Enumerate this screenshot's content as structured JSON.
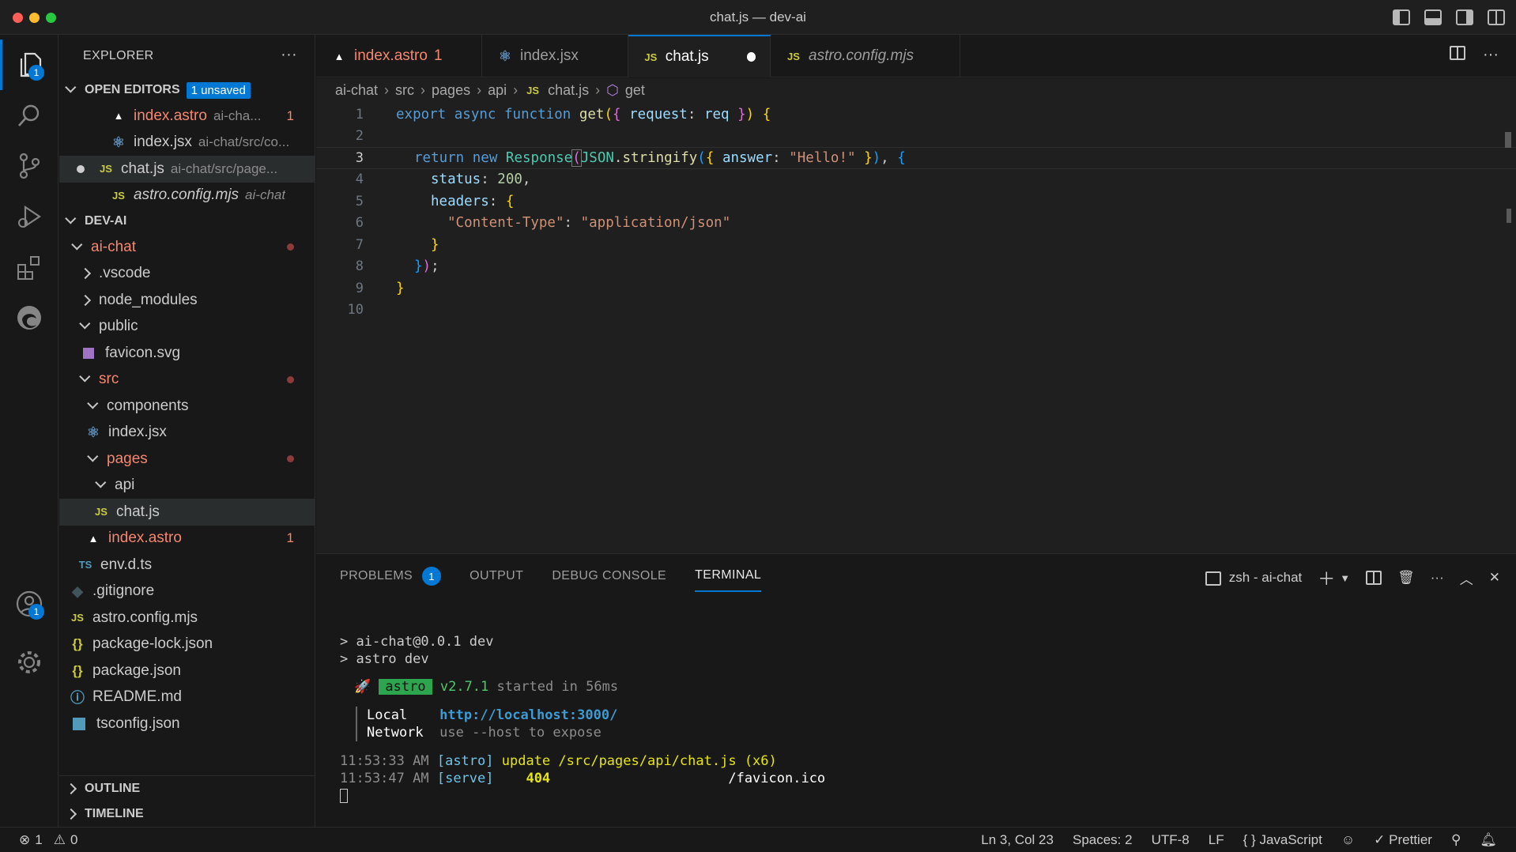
{
  "window": {
    "title": "chat.js — dev-ai"
  },
  "activity": {
    "explorer_badge": "1",
    "accounts_badge": "1"
  },
  "sidebar": {
    "title": "EXPLORER",
    "open_editors": {
      "label": "OPEN EDITORS",
      "badge": "1 unsaved",
      "items": [
        {
          "name": "index.astro",
          "desc": "ai-cha...",
          "count": "1"
        },
        {
          "name": "index.jsx",
          "desc": "ai-chat/src/co..."
        },
        {
          "name": "chat.js",
          "desc": "ai-chat/src/page..."
        },
        {
          "name": "astro.config.mjs",
          "desc": "ai-chat"
        }
      ]
    },
    "workspace": {
      "label": "DEV-AI",
      "items": [
        {
          "name": "ai-chat"
        },
        {
          "name": ".vscode"
        },
        {
          "name": "node_modules"
        },
        {
          "name": "public"
        },
        {
          "name": "favicon.svg"
        },
        {
          "name": "src"
        },
        {
          "name": "components"
        },
        {
          "name": "index.jsx"
        },
        {
          "name": "pages"
        },
        {
          "name": "api"
        },
        {
          "name": "chat.js"
        },
        {
          "name": "index.astro",
          "count": "1"
        },
        {
          "name": "env.d.ts"
        },
        {
          "name": ".gitignore"
        },
        {
          "name": "astro.config.mjs"
        },
        {
          "name": "package-lock.json"
        },
        {
          "name": "package.json"
        },
        {
          "name": "README.md"
        },
        {
          "name": "tsconfig.json"
        }
      ]
    },
    "outline": "OUTLINE",
    "timeline": "TIMELINE"
  },
  "tabs": [
    {
      "label": "index.astro",
      "error": "1"
    },
    {
      "label": "index.jsx"
    },
    {
      "label": "chat.js"
    },
    {
      "label": "astro.config.mjs"
    }
  ],
  "breadcrumb": [
    "ai-chat",
    "src",
    "pages",
    "api",
    "chat.js",
    "get"
  ],
  "editor": {
    "line_numbers": [
      "1",
      "2",
      "3",
      "4",
      "5",
      "6",
      "7",
      "8",
      "9",
      "10"
    ],
    "current_line": 3
  },
  "panel": {
    "tabs": [
      "PROBLEMS",
      "OUTPUT",
      "DEBUG CONSOLE",
      "TERMINAL"
    ],
    "problems_count": "1",
    "terminal_name": "zsh - ai-chat",
    "lines": {
      "l1": "> ai-chat@0.0.1 dev",
      "l2": "> astro dev",
      "astro_tag": "astro",
      "version": "v2.7.1",
      "started": "started in 56ms",
      "local_label": "Local",
      "local_url": "http://localhost:3000/",
      "network_label": "Network",
      "network_val": "use --host to expose",
      "log1_time": "11:53:33 AM",
      "log1_tag": "[astro]",
      "log1_msg": "update /src/pages/api/chat.js",
      "log1_count": "(x6)",
      "log2_time": "11:53:47 AM",
      "log2_tag": "[serve]",
      "log2_status": "404",
      "log2_path": "/favicon.ico"
    }
  },
  "status": {
    "errors": "1",
    "warnings": "0",
    "position": "Ln 3, Col 23",
    "spaces": "Spaces: 2",
    "encoding": "UTF-8",
    "eol": "LF",
    "language": "JavaScript",
    "prettier": "Prettier"
  }
}
